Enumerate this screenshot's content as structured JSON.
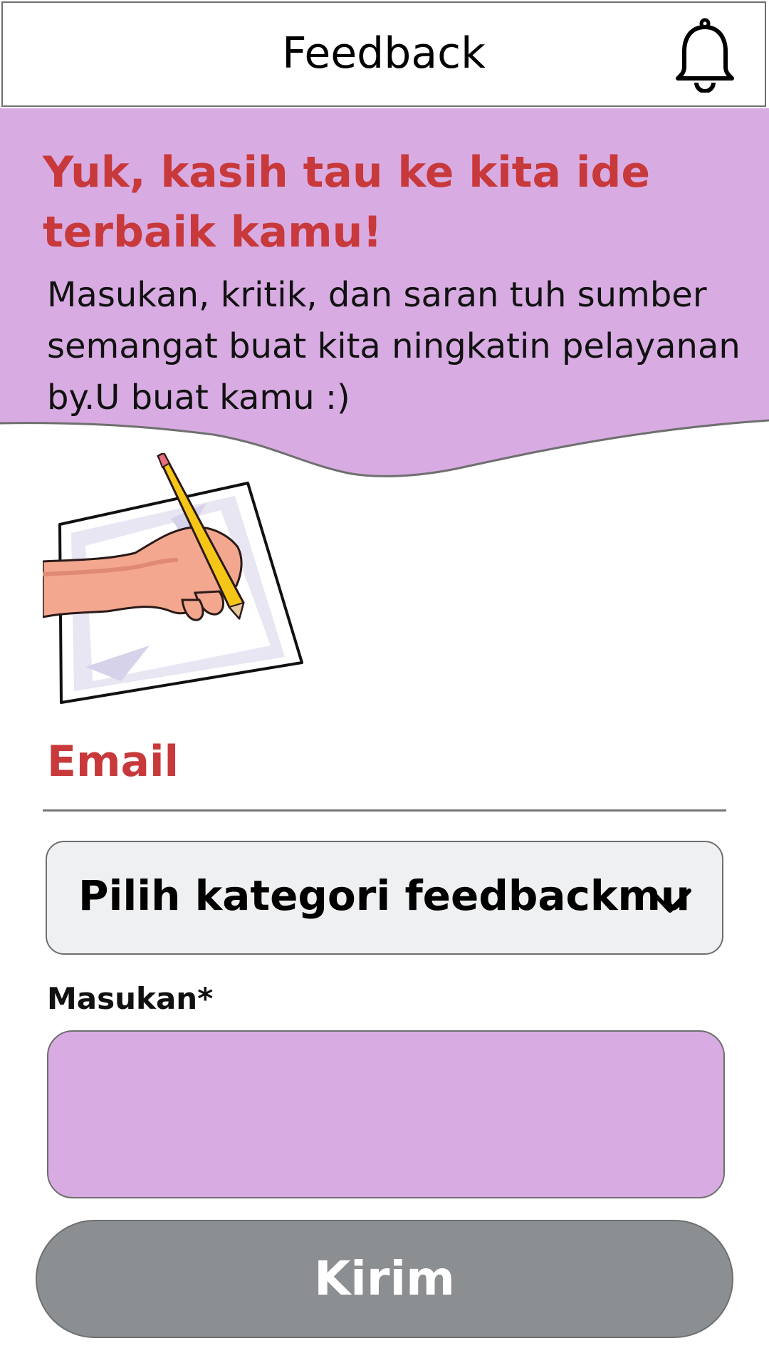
{
  "header": {
    "title": "Feedback",
    "notification_icon": "bell-icon"
  },
  "banner": {
    "title": "Yuk, kasih tau ke kita ide terbaik kamu!",
    "text": "Masukan, kritik, dan saran tuh sumber semangat buat kita ningkatin pelayanan by.U buat kamu :)",
    "background_color": "#d8ace2",
    "title_color": "#c8393b"
  },
  "illustration": {
    "icon": "hand-writing-illustration"
  },
  "form": {
    "email_label": "Email",
    "category_placeholder": "Pilih kategori feedbackmu",
    "category_icon": "chevron-down-icon",
    "masukan_label": "Masukan*",
    "masukan_value": "",
    "submit_label": "Kirim",
    "submit_color": "#8b8f92"
  }
}
